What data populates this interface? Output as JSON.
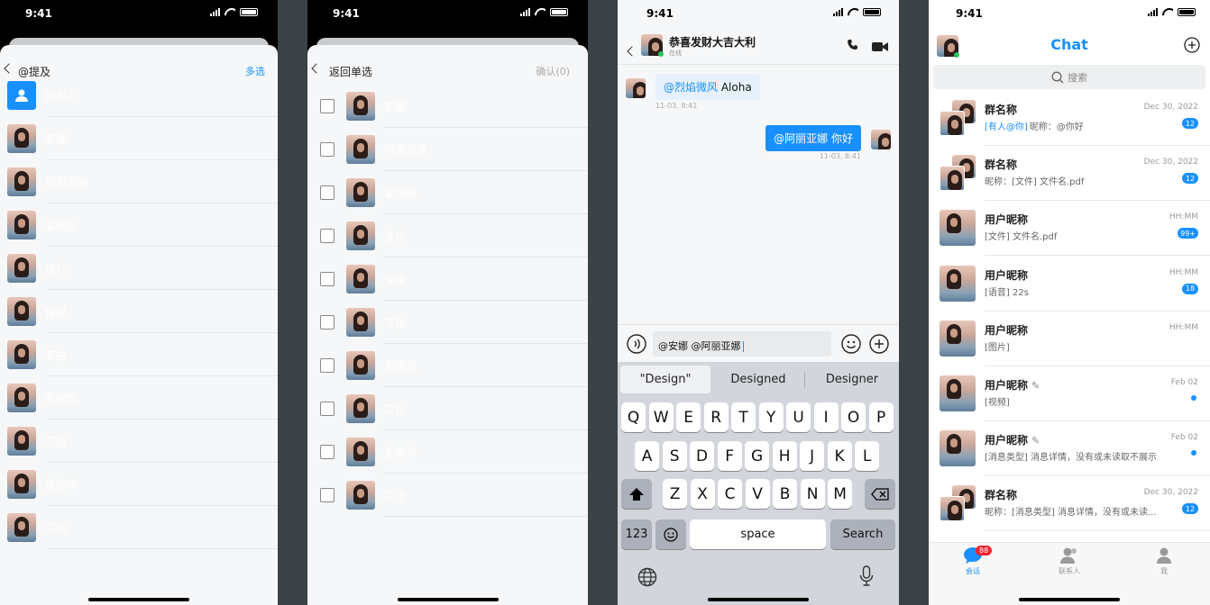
{
  "status": {
    "time": "9:41"
  },
  "mention_screen": {
    "title": "@提及",
    "multi_select_label": "多选",
    "all_members_label": "所有人",
    "members": [
      "安娜",
      "阿里亚娜",
      "爱丽丝",
      "波儿",
      "保禄",
      "艾拉",
      "爱德华",
      "艾拉",
      "爱德华",
      "艾拉"
    ]
  },
  "multi_select_screen": {
    "title": "返回单选",
    "confirm_label": "确认(0)",
    "members": [
      "安娜",
      "阿里亚娜",
      "爱丽丝",
      "波儿",
      "保禄",
      "艾拉",
      "爱德华",
      "艾拉",
      "爱德华",
      "艾拉"
    ]
  },
  "chat_screen": {
    "group_name": "恭喜发财大吉大利",
    "presence": "在线",
    "messages": [
      {
        "direction": "in",
        "mention": "@烈焰微风",
        "text": "Aloha",
        "time": "11-03, 8:41"
      },
      {
        "direction": "out",
        "text": "@阿丽亚娜 你好",
        "time": "11-03, 8:41"
      }
    ],
    "input_value": "@安娜 @阿丽亚娜",
    "suggestions": [
      "\"Design\"",
      "Designed",
      "Designer"
    ],
    "keyboard": {
      "row1": [
        "Q",
        "W",
        "E",
        "R",
        "T",
        "Y",
        "U",
        "I",
        "O",
        "P"
      ],
      "row2": [
        "A",
        "S",
        "D",
        "F",
        "G",
        "H",
        "J",
        "K",
        "L"
      ],
      "row3": [
        "Z",
        "X",
        "C",
        "V",
        "B",
        "N",
        "M"
      ],
      "num_label": "123",
      "space_label": "space",
      "search_label": "Search"
    }
  },
  "list_screen": {
    "title": "Chat",
    "search_placeholder": "搜索",
    "conversations": [
      {
        "name": "群名称",
        "tag": "[有人@你]",
        "preview": "昵称：@你好",
        "time": "Dec 30, 2022",
        "badge": "12",
        "group": true
      },
      {
        "name": "群名称",
        "tag": "",
        "preview": "昵称：[文件] 文件名.pdf",
        "time": "Dec 30, 2022",
        "badge": "12",
        "group": true
      },
      {
        "name": "用户昵称",
        "tag": "",
        "preview": "[文件] 文件名.pdf",
        "time": "HH:MM",
        "badge": "99+",
        "group": false
      },
      {
        "name": "用户昵称",
        "tag": "",
        "preview": "[语音] 22s",
        "time": "HH:MM",
        "badge": "18",
        "group": false
      },
      {
        "name": "用户昵称",
        "tag": "",
        "preview": "[图片]",
        "time": "HH:MM",
        "badge": "",
        "group": false
      },
      {
        "name": "用户昵称",
        "tag": "",
        "preview": "[视频]",
        "time": "Feb 02",
        "badge": "dot",
        "group": false,
        "muted": true
      },
      {
        "name": "用户昵称",
        "tag": "",
        "preview": "[消息类型] 消息详情，没有或未读取不展示",
        "time": "Feb 02",
        "badge": "dot",
        "group": false,
        "muted": true
      },
      {
        "name": "群名称",
        "tag": "",
        "preview": "昵称：[消息类型] 消息详情，没有或未读...",
        "time": "Dec 30, 2022",
        "badge": "12",
        "group": true
      }
    ],
    "tabs": [
      {
        "label": "会话",
        "badge": "88",
        "active": true
      },
      {
        "label": "联系人",
        "badge": "",
        "active": false
      },
      {
        "label": "我",
        "badge": "",
        "active": false
      }
    ],
    "accent": "#1890ff"
  }
}
